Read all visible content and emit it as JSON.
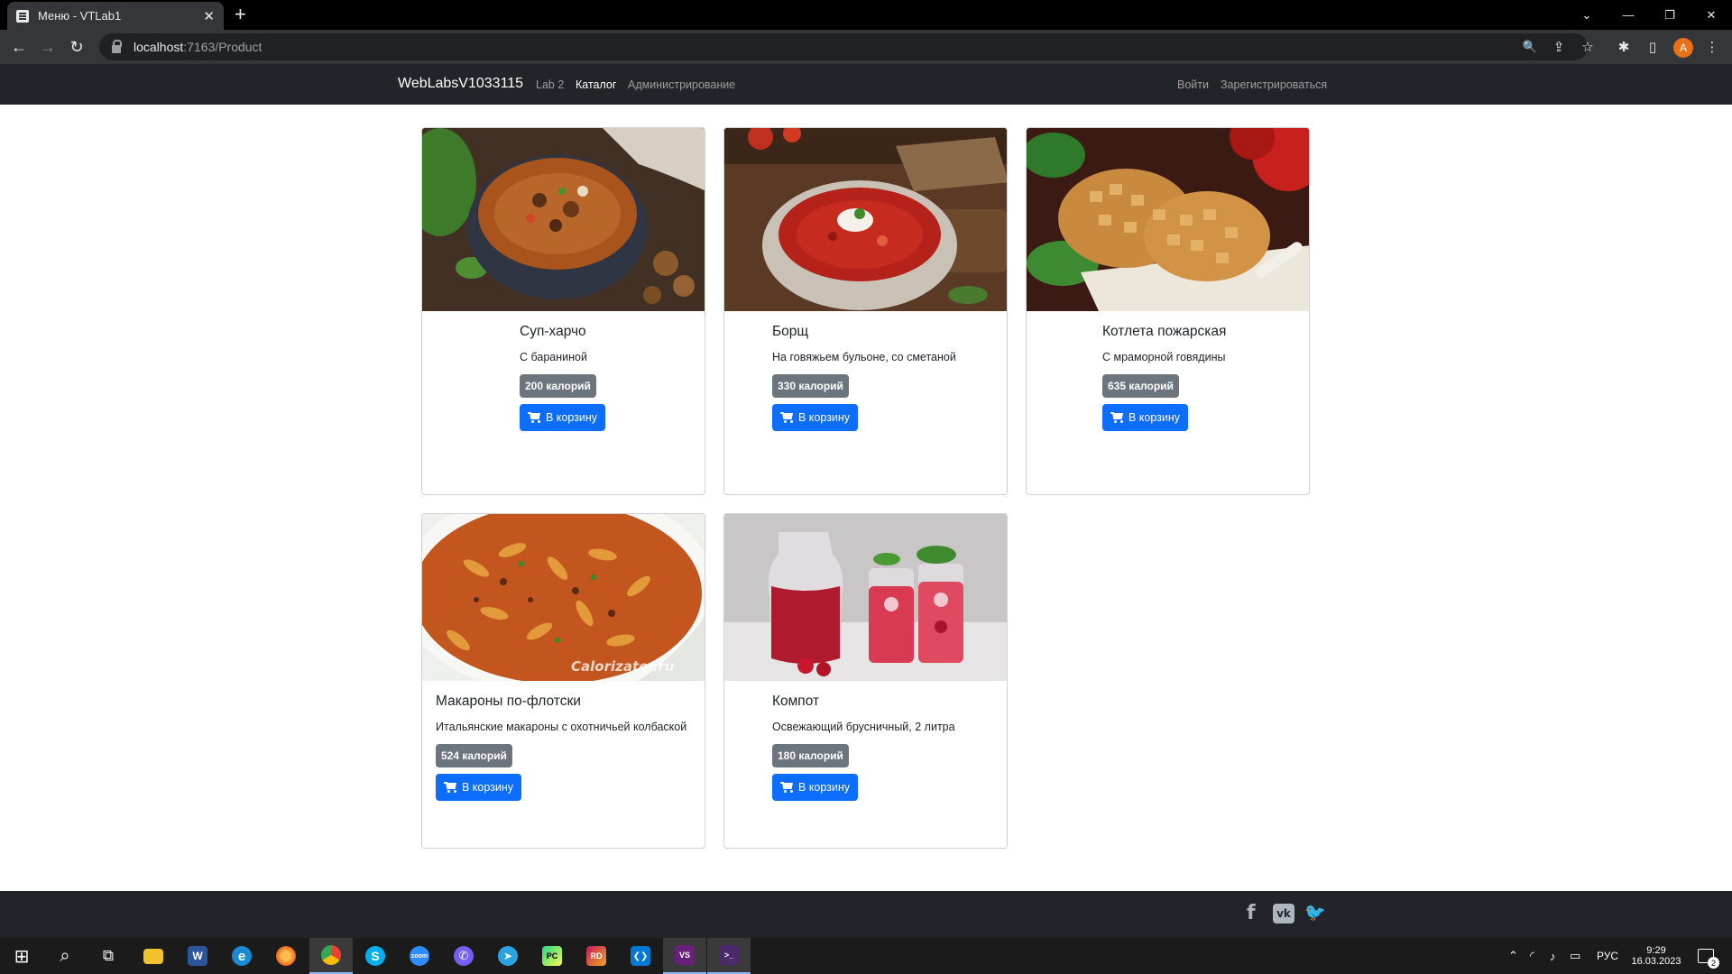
{
  "browser": {
    "tab_title": "Меню - VTLab1",
    "tab_close": "✕",
    "new_tab": "+",
    "url_host": "localhost",
    "url_path": ":7163/Product",
    "profile_initial": "A",
    "window_controls": [
      "⌄",
      "—",
      "❐",
      "✕"
    ],
    "nav_icons": [
      "←",
      "→",
      "↻"
    ],
    "toolbar_icons": [
      "🔍",
      "⇪",
      "☆",
      "✱",
      "▯",
      "⋮"
    ]
  },
  "navbar": {
    "brand": "WebLabsV1033115",
    "links": [
      {
        "label": "Lab 2",
        "active": false
      },
      {
        "label": "Каталог",
        "active": true
      },
      {
        "label": "Администрирование",
        "active": false
      }
    ],
    "login": "Войти",
    "register": "Зарегистрироваться"
  },
  "products": [
    {
      "name": "Суп-харчо",
      "description": "С бараниной",
      "calories": "200 калорий",
      "button": "В корзину",
      "image": "kharcho-soup"
    },
    {
      "name": "Борщ",
      "description": "На говяжьем бульоне, со сметаной",
      "calories": "330 калорий",
      "button": "В корзину",
      "image": "borscht"
    },
    {
      "name": "Котлета пожарская",
      "description": "С мраморной говядины",
      "calories": "635 калорий",
      "button": "В корзину",
      "image": "pozharsky-cutlet"
    },
    {
      "name": "Макароны по-флотски",
      "description": "Итальянские макароны с охотничьей колбаской",
      "calories": "524 калорий",
      "button": "В корзину",
      "image": "navy-pasta"
    },
    {
      "name": "Компот",
      "description": "Освежающий брусничный, 2 литра",
      "calories": "180 калорий",
      "button": "В корзину",
      "image": "compote"
    }
  ],
  "image_watermark": "Calorizator.ru",
  "footer": {
    "social": [
      {
        "icon": "facebook-icon",
        "glyph": "f"
      },
      {
        "icon": "vk-icon",
        "glyph": "vk"
      },
      {
        "icon": "twitter-icon",
        "glyph": "🐦"
      }
    ]
  },
  "taskbar": {
    "apps": [
      {
        "name": "start",
        "glyph": "⊞",
        "color": "#1b1b1b"
      },
      {
        "name": "search",
        "glyph": "⌕",
        "color": "#1b1b1b"
      },
      {
        "name": "task-view",
        "glyph": "⧉",
        "color": "#1b1b1b"
      },
      {
        "name": "file-explorer",
        "glyph": "",
        "color": "#f2c12e"
      },
      {
        "name": "word",
        "glyph": "W",
        "color": "#2b579a"
      },
      {
        "name": "edge",
        "glyph": "e",
        "color": "#1b8ad4"
      },
      {
        "name": "firefox",
        "glyph": "",
        "color": "#e8641a"
      },
      {
        "name": "chrome",
        "glyph": "",
        "color": "#34a853"
      },
      {
        "name": "skype",
        "glyph": "S",
        "color": "#00aff0"
      },
      {
        "name": "zoom",
        "glyph": "zoom",
        "color": "#2d8cff"
      },
      {
        "name": "viber",
        "glyph": "✆",
        "color": "#7360f2"
      },
      {
        "name": "telegram",
        "glyph": "➤",
        "color": "#2aa3df"
      },
      {
        "name": "pycharm",
        "glyph": "PC",
        "color": "#21d789"
      },
      {
        "name": "rider",
        "glyph": "RD",
        "color": "#c2185b"
      },
      {
        "name": "vscode",
        "glyph": "❮❯",
        "color": "#0078d4"
      },
      {
        "name": "visual-studio",
        "glyph": "VS",
        "color": "#68217a"
      },
      {
        "name": "terminal",
        "glyph": ">_",
        "color": "#4b2a6b"
      }
    ],
    "language": "РУС",
    "time": "9:29",
    "date": "16.03.2023",
    "notifications": "2"
  },
  "colors": {
    "primary": "#0d6efd",
    "badge": "#6c757d",
    "navbar": "#212529"
  }
}
